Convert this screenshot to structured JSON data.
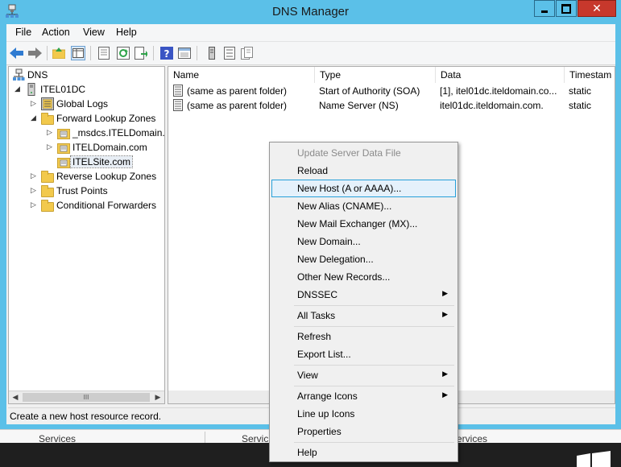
{
  "window": {
    "title": "DNS Manager",
    "close_glyph": "✕"
  },
  "menu": {
    "items": [
      "File",
      "Action",
      "View",
      "Help"
    ]
  },
  "toolbar": {
    "icons": [
      "back-arrow-icon",
      "forward-arrow-icon",
      "up-folder-icon",
      "show-hide-tree-icon",
      "properties-icon",
      "refresh-icon",
      "export-list-icon",
      "help-icon",
      "console-icon",
      "server-icon",
      "list-icon",
      "records-icon"
    ]
  },
  "tree": {
    "root": "DNS",
    "server": "ITEL01DC",
    "global_logs": "Global Logs",
    "forward_zones": "Forward Lookup Zones",
    "zone_msdcs": "_msdcs.ITELDomain.c",
    "zone_iteldomain": "ITELDomain.com",
    "zone_itelsite": "ITELSite.com",
    "reverse_zones": "Reverse Lookup Zones",
    "trust_points": "Trust Points",
    "conditional_forwarders": "Conditional Forwarders",
    "expand_glyph": "▷",
    "collapse_glyph": "◢"
  },
  "list": {
    "columns": [
      "Name",
      "Type",
      "Data",
      "Timestam"
    ],
    "rows": [
      {
        "name": "(same as parent folder)",
        "type": "Start of Authority (SOA)",
        "data": "[1], itel01dc.iteldomain.co...",
        "timestamp": "static"
      },
      {
        "name": "(same as parent folder)",
        "type": "Name Server (NS)",
        "data": "itel01dc.iteldomain.com.",
        "timestamp": "static"
      }
    ]
  },
  "scroll": {
    "left_glyph": "◀",
    "right_glyph": "▶",
    "grip": "III"
  },
  "status": {
    "text": "Create a new host resource record."
  },
  "background": {
    "tabs": [
      "Services",
      "Servic",
      "ervices"
    ]
  },
  "context_menu": {
    "items": [
      {
        "label": "Update Server Data File",
        "disabled": true
      },
      {
        "label": "Reload"
      },
      {
        "label": "New Host (A or AAAA)...",
        "highlighted": true
      },
      {
        "label": "New Alias (CNAME)..."
      },
      {
        "label": "New Mail Exchanger (MX)..."
      },
      {
        "label": "New Domain..."
      },
      {
        "label": "New Delegation..."
      },
      {
        "label": "Other New Records..."
      },
      {
        "label": "DNSSEC",
        "submenu": true
      },
      {
        "label": "All Tasks",
        "submenu": true
      },
      {
        "label": "Refresh"
      },
      {
        "label": "Export List..."
      },
      {
        "label": "View",
        "submenu": true
      },
      {
        "label": "Arrange Icons",
        "submenu": true
      },
      {
        "label": "Line up Icons"
      },
      {
        "label": "Properties"
      },
      {
        "label": "Help"
      }
    ],
    "submenu_glyph": "▶"
  },
  "colors": {
    "titlebar": "#5bc0e8",
    "close_button": "#c7382c",
    "highlight": "#e5f1fb",
    "highlight_border": "#26a0da"
  }
}
